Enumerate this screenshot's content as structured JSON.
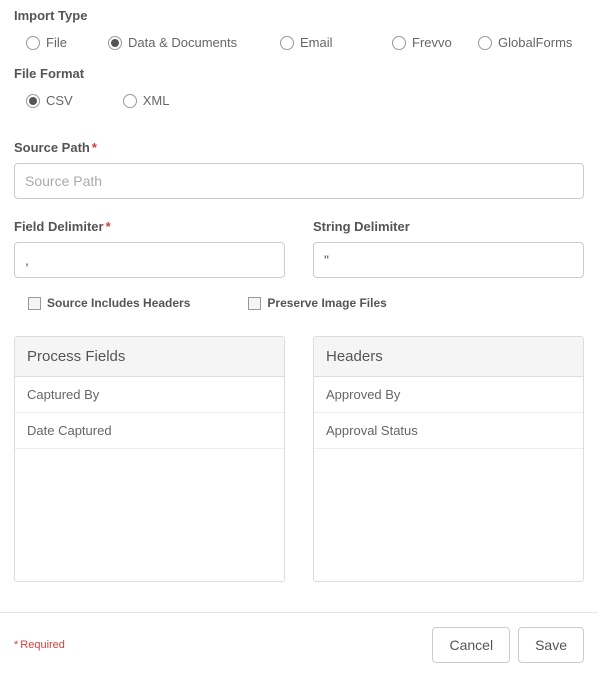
{
  "importType": {
    "label": "Import Type",
    "options": [
      {
        "label": "File",
        "selected": false
      },
      {
        "label": "Data & Documents",
        "selected": true
      },
      {
        "label": "Email",
        "selected": false
      },
      {
        "label": "Frevvo",
        "selected": false
      },
      {
        "label": "GlobalForms",
        "selected": false
      }
    ]
  },
  "fileFormat": {
    "label": "File Format",
    "options": [
      {
        "label": "CSV",
        "selected": true
      },
      {
        "label": "XML",
        "selected": false
      }
    ]
  },
  "sourcePath": {
    "label": "Source Path",
    "required": true,
    "placeholder": "Source Path",
    "value": ""
  },
  "fieldDelimiter": {
    "label": "Field Delimiter",
    "required": true,
    "value": ","
  },
  "stringDelimiter": {
    "label": "String Delimiter",
    "required": false,
    "value": "\""
  },
  "checkboxes": {
    "sourceHeaders": {
      "label": "Source Includes Headers",
      "checked": false
    },
    "preserveImages": {
      "label": "Preserve Image Files",
      "checked": false
    }
  },
  "processFields": {
    "header": "Process Fields",
    "items": [
      "Captured By",
      "Date Captured"
    ]
  },
  "headers": {
    "header": "Headers",
    "items": [
      "Approved By",
      "Approval Status"
    ]
  },
  "footer": {
    "requiredText": "Required",
    "cancel": "Cancel",
    "save": "Save"
  },
  "asterisk": "*"
}
